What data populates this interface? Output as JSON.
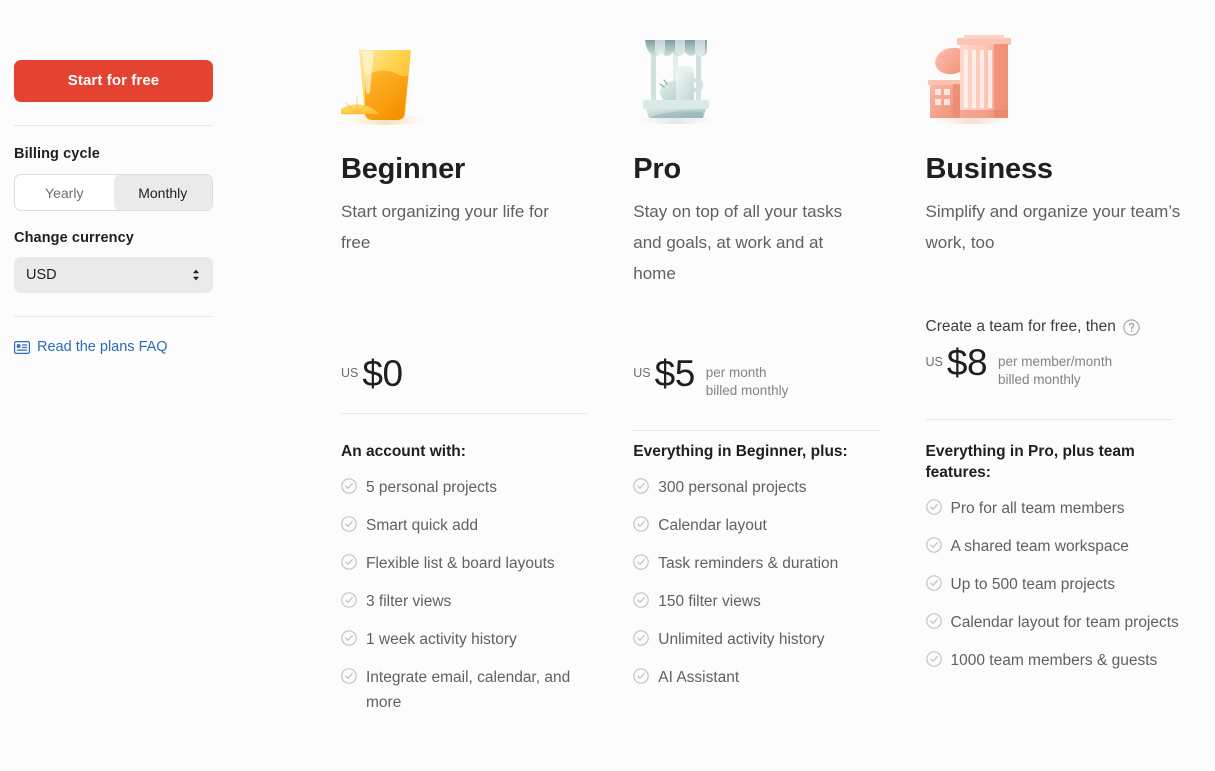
{
  "sidebar": {
    "cta_label": "Start for free",
    "billing_cycle_label": "Billing cycle",
    "billing_options": [
      {
        "label": "Yearly",
        "selected": false
      },
      {
        "label": "Monthly",
        "selected": true
      }
    ],
    "currency_label": "Change currency",
    "currency_value": "USD",
    "faq_link_label": "Read the plans FAQ",
    "faq_icon": "article-list-icon",
    "cta_color": "#e44332",
    "link_color": "#2b6cb8"
  },
  "plans": [
    {
      "art_icon": "orange-juice-glass-icon",
      "name": "Beginner",
      "tagline": "Start organizing your life for free",
      "team_note": null,
      "price": {
        "currency_prefix": "US",
        "amount": "$0",
        "term_line1": "",
        "term_line2": ""
      },
      "features_head": "An account with:",
      "features": [
        "5 personal projects",
        "Smart quick add",
        "Flexible list & board layouts",
        "3 filter views",
        "1 week activity history",
        "Integrate email, calendar, and more"
      ]
    },
    {
      "art_icon": "lemonade-stand-icon",
      "name": "Pro",
      "tagline": "Stay on top of all your tasks and goals, at work and at home",
      "team_note": null,
      "price": {
        "currency_prefix": "US",
        "amount": "$5",
        "term_line1": "per month",
        "term_line2": "billed monthly"
      },
      "features_head": "Everything in Beginner, plus:",
      "features": [
        "300 personal projects",
        "Calendar layout",
        "Task reminders & duration",
        "150 filter views",
        "Unlimited activity history",
        "AI Assistant"
      ]
    },
    {
      "art_icon": "office-building-icon",
      "name": "Business",
      "tagline": "Simplify and organize your team’s work, too",
      "team_note": "Create a team for free, then",
      "team_note_icon": "help-circle-icon",
      "price": {
        "currency_prefix": "US",
        "amount": "$8",
        "term_line1": "per member/month",
        "term_line2": "billed monthly"
      },
      "features_head": "Everything in Pro, plus team features:",
      "features": [
        "Pro for all team members",
        "A shared team workspace",
        "Up to 500 team projects",
        "Calendar layout for team projects",
        "1000 team members & guests"
      ]
    }
  ]
}
